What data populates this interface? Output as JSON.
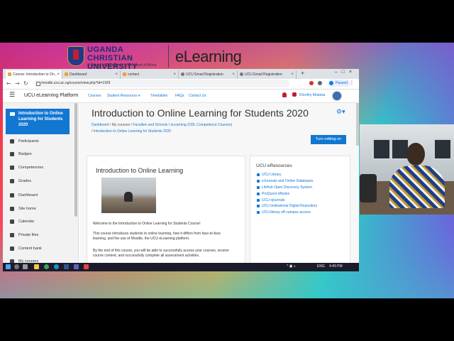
{
  "banner": {
    "university": "UGANDA CHRISTIAN UNIVERSITY",
    "tagline": "A Centre of Excellence in the Heart of Africa",
    "product": "eLearning"
  },
  "browser": {
    "tabs": [
      {
        "title": "Course: Introduction to On..."
      },
      {
        "title": "Dashboard"
      },
      {
        "title": "contact"
      },
      {
        "title": "UCU Email Registration"
      },
      {
        "title": "UCU Email Registration"
      }
    ],
    "new_tab": "+",
    "url": "moodle.ucu.ac.ug/course/view.php?id=1929",
    "profile_state": "Paused"
  },
  "moodle_nav": {
    "brand": "UCU eLearning Platform",
    "links": [
      "Courses",
      "Student Resources ▾",
      "Timetables",
      "FAQs",
      "Contact Us"
    ],
    "user_name": "Dorothy Mukasa"
  },
  "drawer": {
    "active_course": "Introduction to Online Learning for Students 2020",
    "items": [
      {
        "label": "Participants",
        "icon": "users-icon"
      },
      {
        "label": "Badges",
        "icon": "badge-icon"
      },
      {
        "label": "Competencies",
        "icon": "check-square-icon"
      },
      {
        "label": "Grades",
        "icon": "table-icon"
      },
      {
        "label": "Dashboard",
        "icon": "dashboard-icon"
      },
      {
        "label": "Site home",
        "icon": "home-icon"
      },
      {
        "label": "Calendar",
        "icon": "calendar-icon"
      },
      {
        "label": "Private files",
        "icon": "file-icon"
      },
      {
        "label": "Content bank",
        "icon": "content-bank-icon"
      },
      {
        "label": "My courses",
        "icon": "graduation-cap-icon"
      }
    ]
  },
  "page": {
    "title": "Introduction to Online Learning for Students 2020",
    "breadcrumbs": [
      "Dashboard",
      "My courses",
      "Faculties and Schools",
      "eLearning (ODL Competence Courses)",
      "Introduction to Online Learning for Students 2020"
    ],
    "edit_button": "Turn editing on",
    "section_heading": "Introduction to Online Learning",
    "paragraphs": [
      "Welcome to the Introduction to Online Learning for Students Course!",
      "This course introduces students to online learning, how it differs from face-to-face learning, and the use of Moodle, the UCU eLearning platform.",
      "By the end of this course, you will be able to successfully access your courses, receive course content, and successfully complete all assessment activities."
    ]
  },
  "eresources": {
    "heading": "UCU eResources",
    "links": [
      "UCU Library",
      "eJournals and Online Databases",
      "LibHub Open Discovery System",
      "ProQuest eBooks",
      "UCU ejournals",
      "UCU Institutional Digital Repository",
      "UCU library off-campus access"
    ]
  },
  "taskbar": {
    "language": "ENG",
    "time": "4:49 PM"
  },
  "colors": {
    "moodle_blue": "#1177d1",
    "ucu_red": "#c21f2f",
    "ucu_navy": "#1f2f6b"
  }
}
